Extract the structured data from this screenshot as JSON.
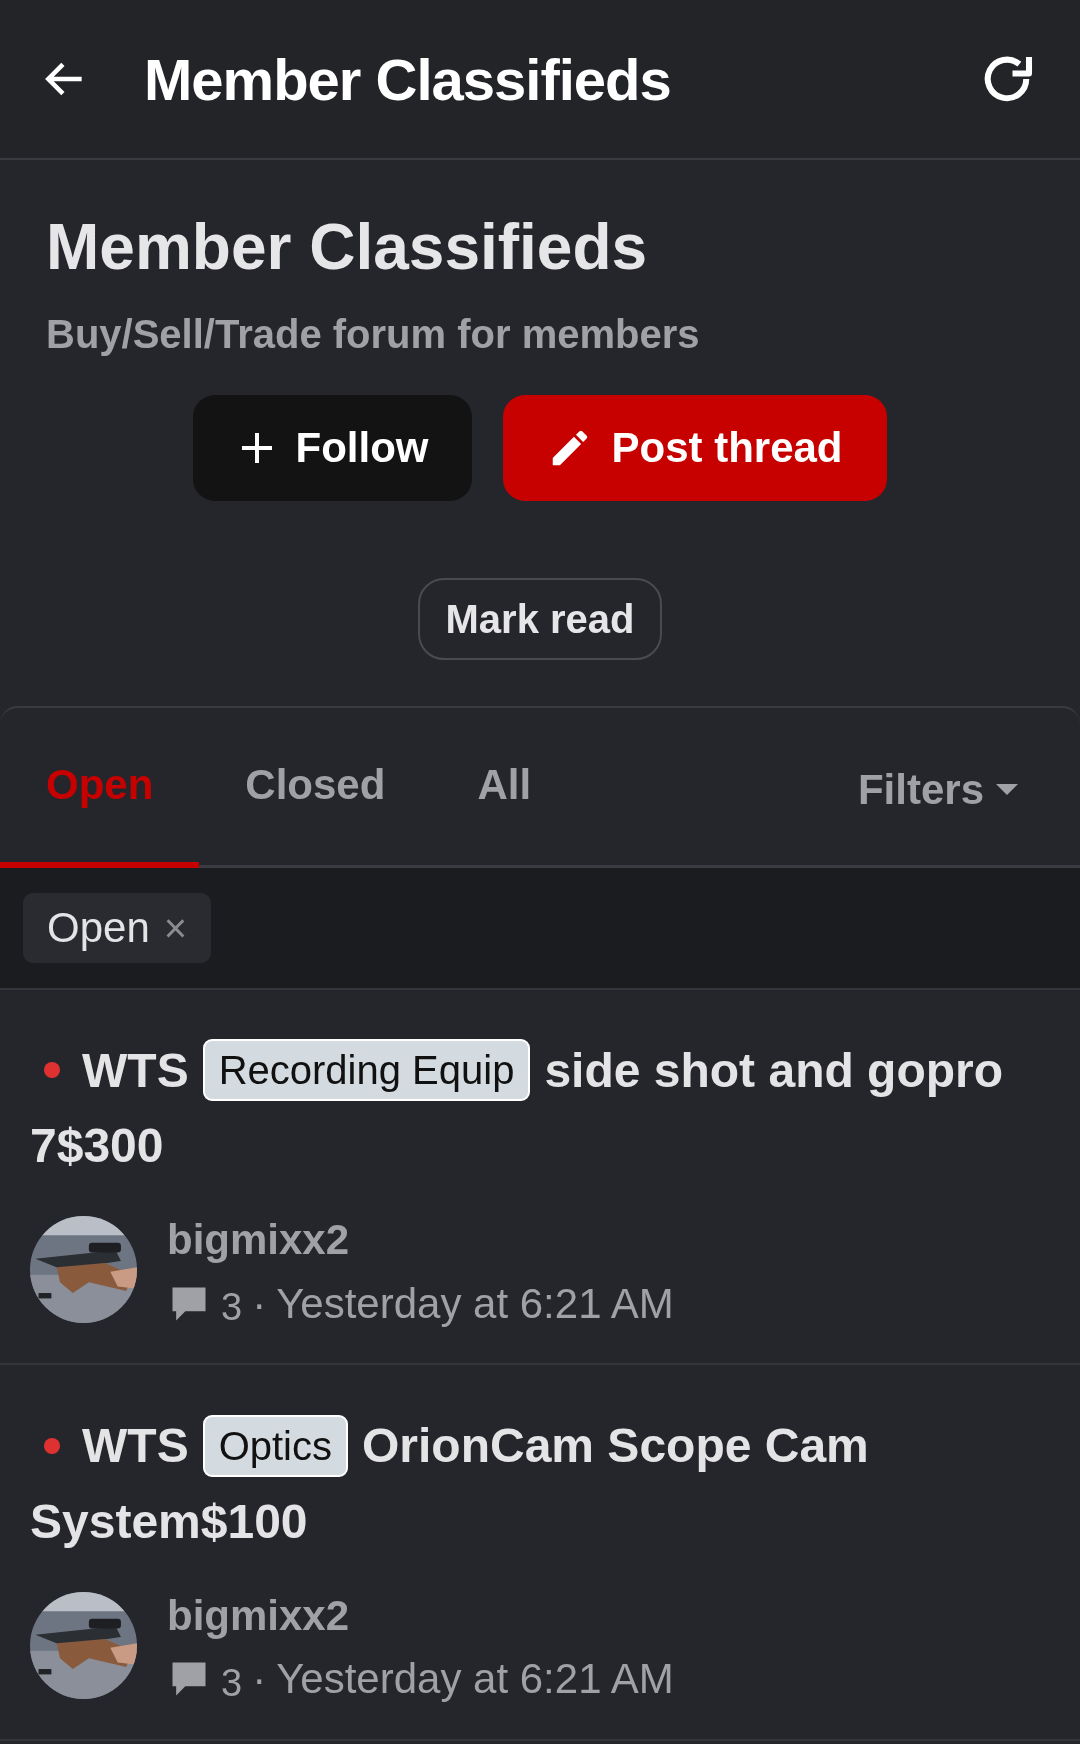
{
  "app_bar": {
    "title": "Member Classifieds"
  },
  "forum": {
    "title": "Member Classifieds",
    "description": "Buy/Sell/Trade forum for members"
  },
  "actions": [
    {
      "kind": "follow",
      "label": "Follow"
    },
    {
      "kind": "post",
      "label": "Post thread"
    }
  ],
  "mark_read": {
    "label": "Mark read"
  },
  "tabs": [
    {
      "label": "Open",
      "selected": true
    },
    {
      "label": "Closed",
      "selected": false
    },
    {
      "label": "All",
      "selected": false
    }
  ],
  "filters": {
    "label": "Filters"
  },
  "active_filters": [
    {
      "label": "Open",
      "remove": "×"
    }
  ],
  "threads": [
    {
      "unread": true,
      "prefix": "WTS",
      "tag": "Recording Equip",
      "title": "side shot and gopro 7$300",
      "author": "bigmixx2",
      "replies": "3",
      "separator": "·",
      "date": "Yesterday at 6:21 AM"
    },
    {
      "unread": true,
      "prefix": "WTS",
      "tag": "Optics",
      "title": "OrionCam Scope Cam System$100",
      "author": "bigmixx2",
      "replies": "3",
      "separator": "·",
      "date": "Yesterday at 6:21 AM"
    }
  ]
}
